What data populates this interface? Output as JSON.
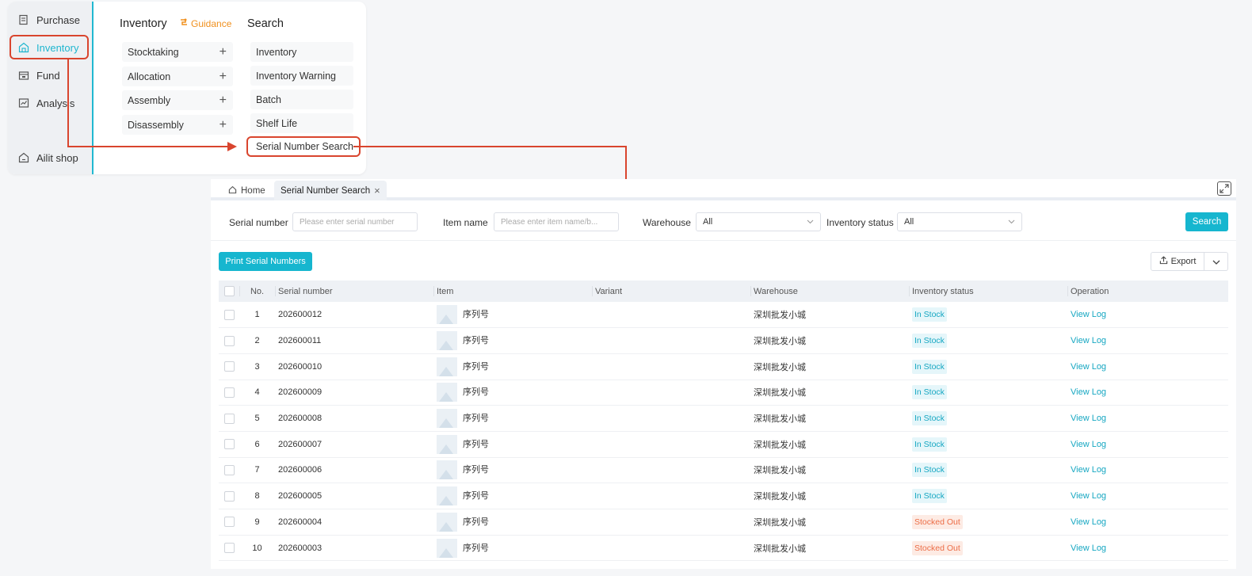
{
  "sidebar": {
    "items": [
      {
        "label": "Purchase",
        "icon": "receipt-icon"
      },
      {
        "label": "Inventory",
        "icon": "warehouse-icon",
        "active": true
      },
      {
        "label": "Fund",
        "icon": "wallet-icon"
      },
      {
        "label": "Analysis",
        "icon": "chart-icon"
      },
      {
        "label": "Ailit shop",
        "icon": "shop-icon"
      }
    ]
  },
  "menu": {
    "inventory_title": "Inventory",
    "guidance_label": "Guidance",
    "search_title": "Search",
    "operations": [
      "Stocktaking",
      "Allocation",
      "Assembly",
      "Disassembly"
    ],
    "search_items": [
      "Inventory",
      "Inventory Warning",
      "Batch",
      "Shelf Life",
      "Serial Number Search"
    ]
  },
  "tabs": {
    "home": "Home",
    "active": "Serial Number Search"
  },
  "filters": {
    "serial_label": "Serial number",
    "serial_placeholder": "Please enter serial number",
    "item_label": "Item name",
    "item_placeholder": "Please enter item name/b...",
    "warehouse_label": "Warehouse",
    "warehouse_value": "All",
    "status_label": "Inventory status",
    "status_value": "All",
    "search_button": "Search"
  },
  "toolbar": {
    "print_button": "Print Serial Numbers",
    "export_button": "Export"
  },
  "table": {
    "columns": [
      "No.",
      "Serial number",
      "Item",
      "Variant",
      "Warehouse",
      "Inventory status",
      "Operation"
    ],
    "rows": [
      {
        "no": "1",
        "serial": "202600012",
        "item": "序列号",
        "variant": "",
        "warehouse": "深圳批发小城",
        "status": "In Stock",
        "status_type": "in",
        "op": "View Log"
      },
      {
        "no": "2",
        "serial": "202600011",
        "item": "序列号",
        "variant": "",
        "warehouse": "深圳批发小城",
        "status": "In Stock",
        "status_type": "in",
        "op": "View Log"
      },
      {
        "no": "3",
        "serial": "202600010",
        "item": "序列号",
        "variant": "",
        "warehouse": "深圳批发小城",
        "status": "In Stock",
        "status_type": "in",
        "op": "View Log"
      },
      {
        "no": "4",
        "serial": "202600009",
        "item": "序列号",
        "variant": "",
        "warehouse": "深圳批发小城",
        "status": "In Stock",
        "status_type": "in",
        "op": "View Log"
      },
      {
        "no": "5",
        "serial": "202600008",
        "item": "序列号",
        "variant": "",
        "warehouse": "深圳批发小城",
        "status": "In Stock",
        "status_type": "in",
        "op": "View Log"
      },
      {
        "no": "6",
        "serial": "202600007",
        "item": "序列号",
        "variant": "",
        "warehouse": "深圳批发小城",
        "status": "In Stock",
        "status_type": "in",
        "op": "View Log"
      },
      {
        "no": "7",
        "serial": "202600006",
        "item": "序列号",
        "variant": "",
        "warehouse": "深圳批发小城",
        "status": "In Stock",
        "status_type": "in",
        "op": "View Log"
      },
      {
        "no": "8",
        "serial": "202600005",
        "item": "序列号",
        "variant": "",
        "warehouse": "深圳批发小城",
        "status": "In Stock",
        "status_type": "in",
        "op": "View Log"
      },
      {
        "no": "9",
        "serial": "202600004",
        "item": "序列号",
        "variant": "",
        "warehouse": "深圳批发小城",
        "status": "Stocked Out",
        "status_type": "out",
        "op": "View Log"
      },
      {
        "no": "10",
        "serial": "202600003",
        "item": "序列号",
        "variant": "",
        "warehouse": "深圳批发小城",
        "status": "Stocked Out",
        "status_type": "out",
        "op": "View Log"
      }
    ]
  },
  "colors": {
    "accent": "#16b6cf",
    "highlight": "#d9452e",
    "in_stock": "#16a7c2",
    "stocked_out": "#ec6d46",
    "guidance": "#f0901e"
  }
}
